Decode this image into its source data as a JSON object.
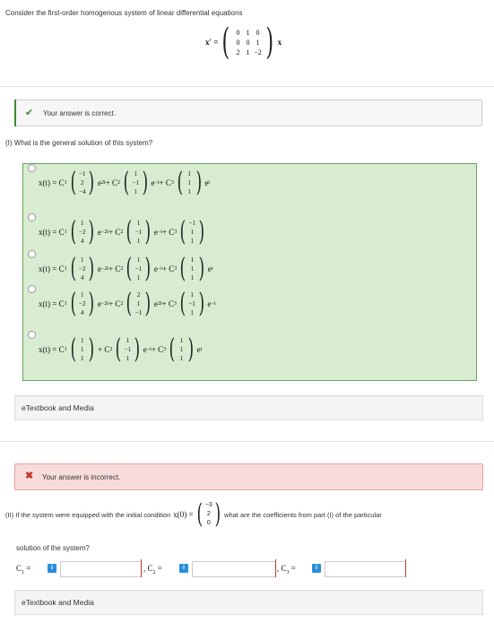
{
  "intro": {
    "prompt": "Consider the first-order homogenous system of linear differential equations",
    "lhs": "x′ =",
    "matrix": [
      [
        "0",
        "1",
        "0"
      ],
      [
        "0",
        "0",
        "1"
      ],
      [
        "2",
        "1",
        "−2"
      ]
    ],
    "rhs": "x"
  },
  "part1": {
    "status": "Your answer is correct.",
    "question": "(I) What is the general solution of this system?",
    "options": [
      {
        "lhs": "x(t) = C",
        "v1": [
          "−1",
          "2",
          "−4"
        ],
        "e1": "e",
        "p1": "2t",
        "c2": "+ C",
        "v2": [
          "1",
          "−1",
          "1"
        ],
        "e2": "e",
        "p2": "−t",
        "c3": "+ C",
        "v3": [
          "1",
          "1",
          "1"
        ],
        "e3": "e",
        "p3": "t"
      },
      {
        "lhs": "x(t) = C",
        "v1": [
          "1",
          "−2",
          "4"
        ],
        "e1": "e",
        "p1": "−2t",
        "c2": "+ C",
        "v2": [
          "1",
          "−1",
          "1"
        ],
        "e2": "e",
        "p2": "−t",
        "c3": "+ C",
        "v3": [
          "−1",
          "1",
          "1"
        ],
        "e3": "",
        "p3": ""
      },
      {
        "lhs": "x(t) = C",
        "v1": [
          "1",
          "−2",
          "4"
        ],
        "e1": "e",
        "p1": "−2t",
        "c2": "+ C",
        "v2": [
          "1",
          "−1",
          "1"
        ],
        "e2": "e",
        "p2": "−t",
        "c3": "+ C",
        "v3": [
          "1",
          "1",
          "1"
        ],
        "e3": "e",
        "p3": "t"
      },
      {
        "lhs": "x(t) = C",
        "v1": [
          "1",
          "−2",
          "4"
        ],
        "e1": "e",
        "p1": "−2t",
        "c2": "+ C",
        "v2": [
          "2",
          "1",
          "−1"
        ],
        "e2": "e",
        "p2": "2t",
        "c3": "+ C",
        "v3": [
          "1",
          "−1",
          "1"
        ],
        "e3": "e",
        "p3": "−t"
      },
      {
        "lhs": "x(t) = C",
        "v1": [
          "1",
          "1",
          "1"
        ],
        "e1": "",
        "p1": "",
        "c2": "+ C",
        "v2": [
          "1",
          "−1",
          "1"
        ],
        "e2": "e",
        "p2": "−t",
        "c3": "+ C",
        "v3": [
          "1",
          "1",
          "1"
        ],
        "e3": "e",
        "p3": "t"
      }
    ],
    "etext": "eTextbook and Media"
  },
  "part2": {
    "status": "Your answer is incorrect.",
    "question_a": "(II) If the system were equipped with the initial condition",
    "ic_lhs": "x(0) =",
    "ic_vector": [
      "−3",
      "2",
      "0"
    ],
    "question_b": "what are the coefficients from part (I) of the particular",
    "question_c": "solution of the system?",
    "c1_label": "C",
    "c2_label": ", C",
    "c3_label": ", C",
    "eq": "=",
    "info": "i",
    "etext": "eTextbook and Media"
  },
  "colors": {
    "green": "#3c8a2e",
    "red": "#c0392b",
    "info_blue": "#2a8fd8",
    "correct_bg": "#d7ecd0"
  }
}
